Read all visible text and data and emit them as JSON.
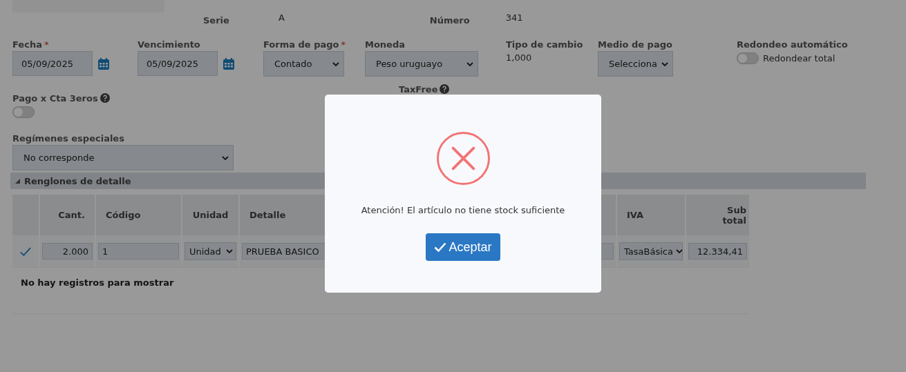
{
  "header": {
    "serie_label": "Serie",
    "serie": "A",
    "numero_label": "Número",
    "numero": "341"
  },
  "field_rows": [
    [
      {
        "kind": "date",
        "label": "Fecha",
        "required_mark": "*",
        "value": "05/09/2025"
      },
      {
        "kind": "date",
        "label": "Vencimiento",
        "value": "05/09/2025"
      },
      {
        "kind": "select",
        "label": "Forma de pago",
        "required_mark": "*",
        "value": "Contado"
      },
      {
        "kind": "select",
        "label": "Moneda",
        "value": "Peso uruguayo"
      },
      {
        "kind": "text",
        "label": "Tipo de cambio",
        "value": "1,000"
      },
      {
        "kind": "select",
        "label": "Medio de pago",
        "value": "Selecciona"
      },
      {
        "kind": "toggle",
        "label": "Redondeo automático",
        "toggle_label": "Redondear total",
        "on": false
      }
    ],
    [
      {
        "kind": "toggle",
        "label": "Pago x Cta 3eros",
        "help": true,
        "on": false
      },
      {
        "kind": "label",
        "label": "TaxFree",
        "help": true
      }
    ],
    [
      {
        "kind": "select",
        "label": "Regímenes especiales",
        "value": "No corresponde"
      }
    ]
  ],
  "detail": {
    "title": "Renglones de detalle",
    "expanded": true,
    "columns": [
      "Cant.",
      "Código",
      "Unidad",
      "Detalle",
      "IVA",
      "Sub total"
    ],
    "rows": [
      {
        "checked": true,
        "cant": "2.000",
        "codigo": "1",
        "unidad": "Unidad",
        "detalle": "PRUEBA BASICO",
        "iva": "TasaBásica",
        "subtotal": "12.334,41"
      }
    ],
    "empty_message": "No hay registros para mostrar"
  },
  "dialog": {
    "message": "Atención! El artículo no tiene stock suficiente",
    "button": "Aceptar"
  }
}
